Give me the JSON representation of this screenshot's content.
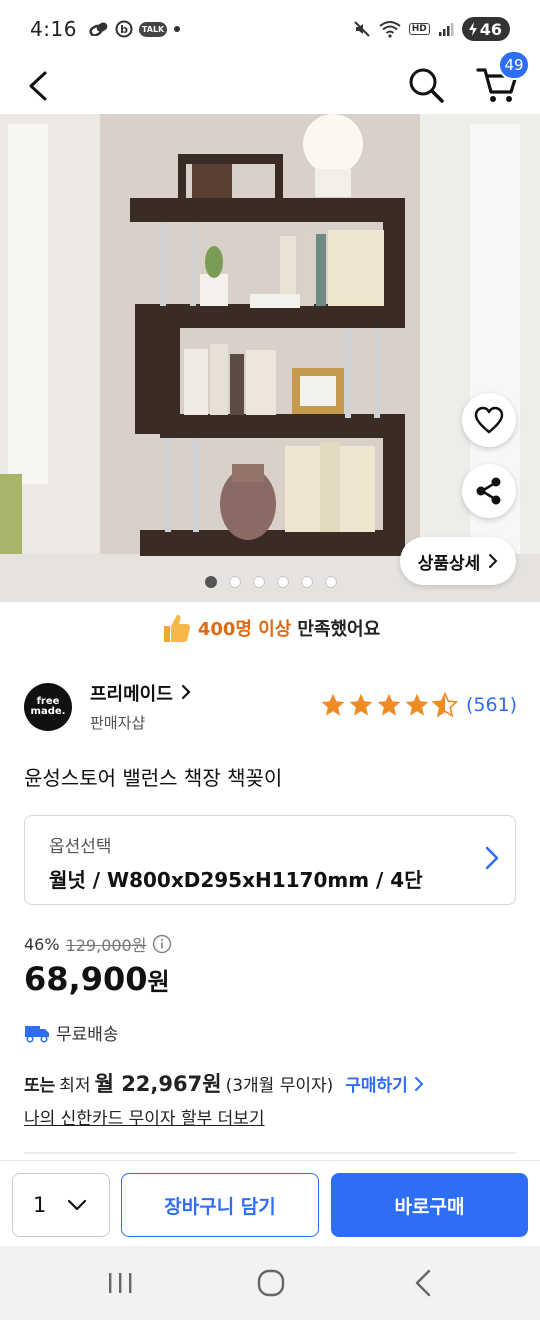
{
  "status_bar": {
    "time": "4:16",
    "battery": "46",
    "icons": [
      "link-icon",
      "b-app-icon",
      "talk-icon",
      "dot-icon",
      "mute-icon",
      "wifi-icon",
      "hd-icon",
      "signal-icon",
      "battery-icon"
    ],
    "talk_label": "TALK",
    "hd_label": "HD"
  },
  "nav": {
    "cart_count": "49"
  },
  "product_image": {
    "detail_button_label": "상품상세",
    "slide_count": 6,
    "active_slide": 1
  },
  "satisfaction": {
    "count_text": "400명 이상",
    "suffix": "만족했어요"
  },
  "seller": {
    "logo_line1": "free",
    "logo_line2": "made.",
    "name": "프리메이드",
    "type": "판매자샵"
  },
  "rating": {
    "stars": 4.5,
    "review_count": "(561)"
  },
  "product": {
    "title": "윤성스토어 밸런스 책장 책꽂이"
  },
  "option": {
    "label": "옵션선택",
    "value": "월넛 / W800xD295xH1170mm / 4단"
  },
  "price": {
    "discount_rate": "46%",
    "original": "129,000원",
    "amount": "68,900",
    "unit": "원"
  },
  "shipping": {
    "label": "무료배송"
  },
  "installment": {
    "or_label": "또는",
    "min_label": "최저",
    "monthly_label": "월 22,967원",
    "condition": "(3개월 무이자)",
    "buy_label": "구매하기"
  },
  "card_link": "나의 신한카드 무이자 할부 더보기",
  "action_bar": {
    "quantity": "1",
    "add_to_cart": "장바구니 담기",
    "buy_now": "바로구매"
  },
  "colors": {
    "accent": "#2e6df6",
    "satisfaction_orange": "#e06a12",
    "star": "#f08a24"
  }
}
